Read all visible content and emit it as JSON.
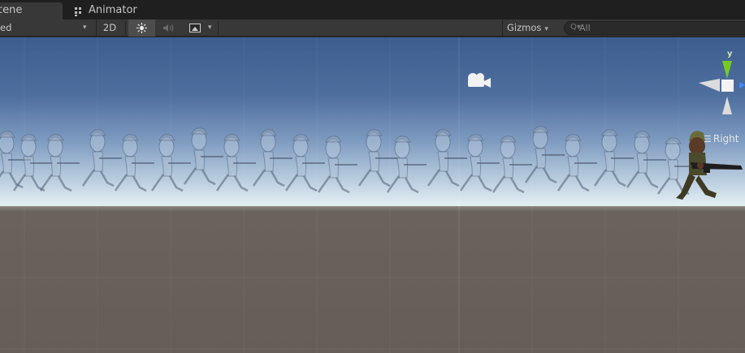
{
  "tabs": {
    "scene_label": "cene",
    "animator_label": "Animator"
  },
  "toolbar": {
    "shading_mode": "ed",
    "mode_2d": "2D",
    "gizmos_label": "Gizmos",
    "search_placeholder": "All"
  },
  "scene": {
    "orientation_label": "Right",
    "axis_y_label": "y",
    "colors": {
      "sky_top": "#3d5d8f",
      "horizon": "#e7eef1",
      "ground": "#655d57",
      "axis_y": "#7ed321",
      "axis_x": "#3c8cff"
    }
  },
  "icons": [
    "animator-icon",
    "dropdown-arrow-icon",
    "sun-icon",
    "audio-icon",
    "effects-icon",
    "search-icon",
    "camera-icon",
    "menu-icon"
  ]
}
